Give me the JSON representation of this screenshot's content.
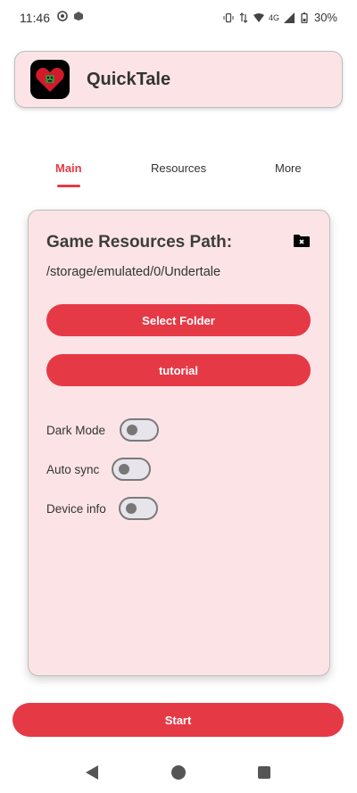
{
  "status_bar": {
    "time": "11:46",
    "network": "4G",
    "battery": "30%"
  },
  "app": {
    "title": "QuickTale"
  },
  "tabs": [
    {
      "label": "Main",
      "active": true
    },
    {
      "label": "Resources",
      "active": false
    },
    {
      "label": "More",
      "active": false
    }
  ],
  "card": {
    "heading": "Game Resources Path:",
    "path": "/storage/emulated/0/Undertale",
    "select_folder_label": "Select Folder",
    "tutorial_label": "tutorial",
    "toggles": [
      {
        "label": "Dark Mode",
        "on": false
      },
      {
        "label": "Auto sync",
        "on": false
      },
      {
        "label": "Device info",
        "on": false
      }
    ]
  },
  "start_label": "Start",
  "colors": {
    "accent": "#e63946",
    "card_bg": "#fce4e6"
  }
}
